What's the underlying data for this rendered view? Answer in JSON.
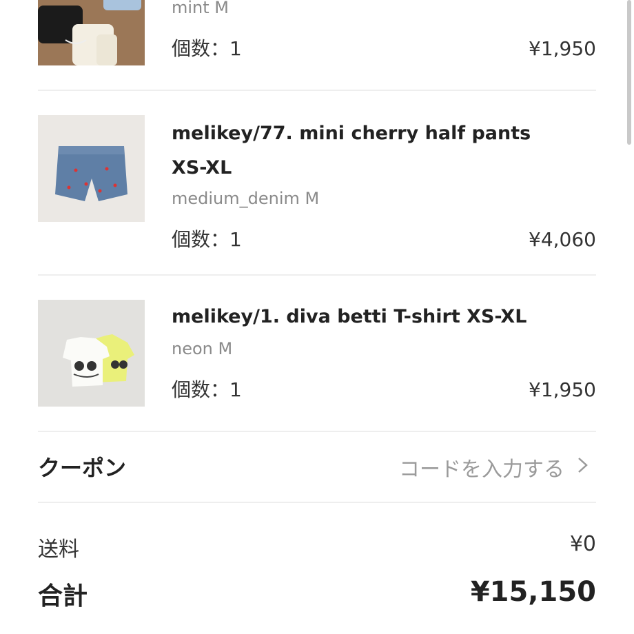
{
  "items": [
    {
      "name": "",
      "variant": "mint M",
      "qty_label": "個数：1",
      "price": "¥1,950",
      "image": "product-photo-knit-shorts"
    },
    {
      "name": "melikey/77. mini cherry half pants XS-XL",
      "variant": "medium_denim M",
      "qty_label": "個数：1",
      "price": "¥4,060",
      "image": "product-photo-denim-shorts"
    },
    {
      "name": "melikey/1. diva betti T-shirt XS-XL",
      "variant": "neon M",
      "qty_label": "個数：1",
      "price": "¥1,950",
      "image": "product-photo-tshirts"
    }
  ],
  "coupon": {
    "label": "クーポン",
    "cta": "コードを入力する"
  },
  "summary": {
    "shipping_label": "送料",
    "shipping_value": "¥0",
    "total_label": "合計",
    "total_value": "¥15,150"
  },
  "colors": {
    "divider": "#eeeeee",
    "muted_text": "#8a8a8a",
    "text": "#222222"
  }
}
